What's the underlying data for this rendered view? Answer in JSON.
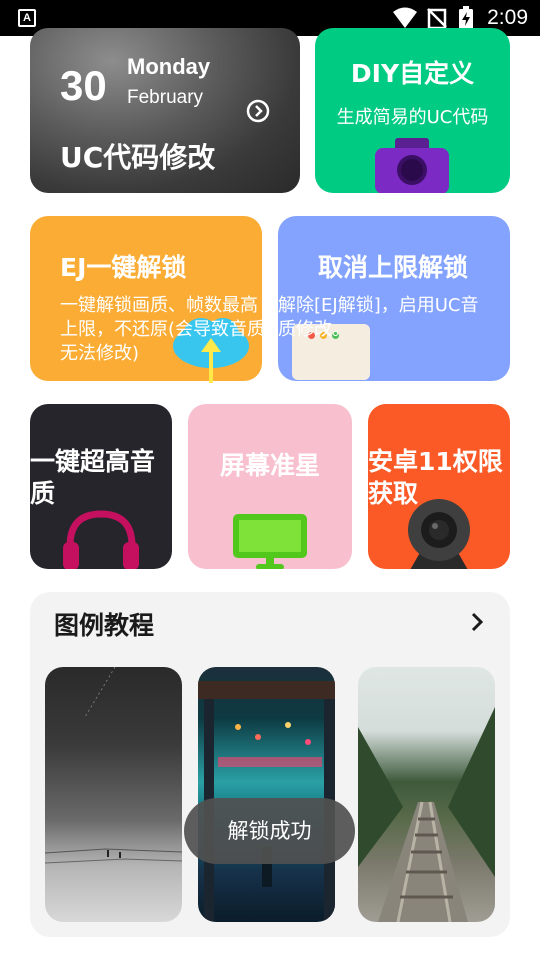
{
  "status_bar": {
    "time": "2:09",
    "app_badge": "A"
  },
  "cards": {
    "uc": {
      "day": "30",
      "weekday": "Monday",
      "month": "February",
      "title": "UC代码修改"
    },
    "diy": {
      "title": "DIY自定义",
      "subtitle": "生成简易的UC代码"
    },
    "ej": {
      "title": "EJ一键解锁",
      "desc": "一键解锁画质、帧数最高上限，不还原(会导致音质无法修改)"
    },
    "cancel": {
      "title": "取消上限解锁",
      "desc": "解除[EJ解锁]，启用UC音质修改。"
    },
    "audio": {
      "title": "一键超高音质"
    },
    "screen": {
      "title": "屏幕准星"
    },
    "android": {
      "title": "安卓11权限获取"
    }
  },
  "tutorial": {
    "title": "图例教程"
  },
  "toast": {
    "text": "解锁成功"
  },
  "colors": {
    "diy": "#00cb82",
    "ej": "#fbac34",
    "cancel": "#84a3ff",
    "audio": "#26252c",
    "screen": "#f8c0cf",
    "android": "#fb5a26"
  },
  "icons": [
    "signal-icon",
    "no-sim-icon",
    "battery-charging-icon",
    "chevron-right-circle-icon",
    "camera-icon",
    "cloud-upload-icon",
    "window-icon",
    "headphones-icon",
    "monitor-icon",
    "webcam-icon",
    "chevron-right-icon"
  ]
}
